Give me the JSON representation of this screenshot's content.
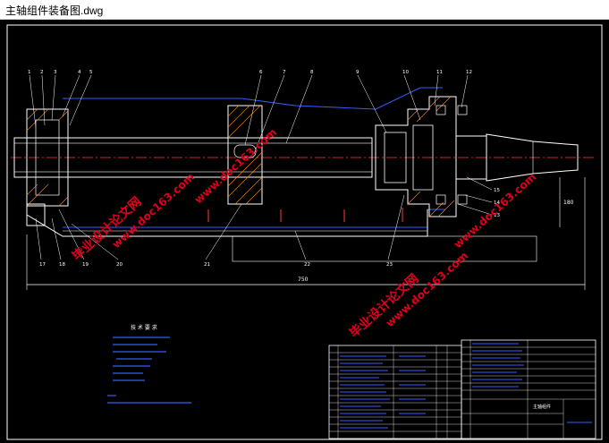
{
  "window": {
    "title": "主轴组件装备图.dwg"
  },
  "drawing": {
    "background_color": "#000000",
    "line_color": "#ffffff",
    "accent_colors": {
      "center_line": "#ff3b3b",
      "dimension": "#ff3b3b",
      "hatch": "#ff8a00",
      "outline_blue": "#3a5bff",
      "leader": "#ffffff",
      "watermark": "#e0001a"
    },
    "balloons_top": [
      "1",
      "2",
      "3",
      "4",
      "5",
      "6",
      "7",
      "8",
      "9",
      "10",
      "11",
      "12"
    ],
    "balloons_bottom": [
      "17",
      "18",
      "19",
      "20",
      "21",
      "22",
      "23"
    ],
    "balloons_right": [
      "15",
      "14",
      "13"
    ],
    "overall_dimension": "750",
    "right_dimension": "180",
    "tech_requirements": {
      "title": "技 术 要 求"
    },
    "title_block": {
      "drawing_name": "主轴组件"
    },
    "watermarks": [
      {
        "main": "毕业设计论文网",
        "url": "www.doc163.com"
      },
      {
        "main": "毕业设计论文网",
        "url": "www.doc163.com"
      },
      {
        "main": "",
        "url": "www.doc163.com"
      },
      {
        "main": "",
        "url": "www.doc163.com"
      }
    ]
  }
}
